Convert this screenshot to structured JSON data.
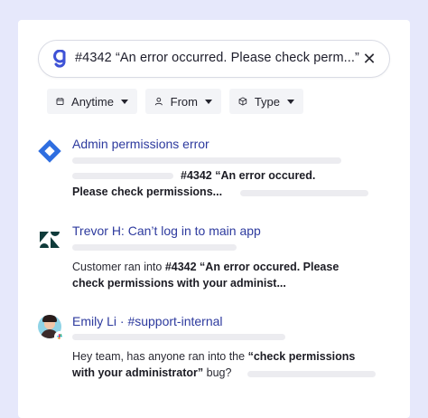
{
  "search": {
    "query": "#4342 “An error occurred. Please check perm...”",
    "clear_icon": "close-icon",
    "logo_icon": "g-logo-icon"
  },
  "filters": [
    {
      "label": "Anytime",
      "icon": "calendar-icon"
    },
    {
      "label": "From",
      "icon": "person-icon"
    },
    {
      "label": "Type",
      "icon": "cube-icon"
    }
  ],
  "results": [
    {
      "title": "Admin permissions error",
      "icon": "jira-icon",
      "snippet_line1_bold": "#4342 “An error occured.",
      "snippet_line2_bold": "Please check permissions..."
    },
    {
      "title": "Trevor H: Can’t log in to main app",
      "icon": "zendesk-icon",
      "snippet_line1_prefix": "Customer ran into ",
      "snippet_line1_bold": "#4342 “An error occured. Please",
      "snippet_line2_bold": "check permissions with your administ..."
    },
    {
      "title": "Emily Li · #support-internal",
      "icon": "avatar-slack",
      "snippet_line1_prefix": "Hey team, has anyone ran into the ",
      "snippet_line1_bold": "“check permissions",
      "snippet_line2_bold": "with your administrator”",
      "snippet_line2_suffix": " bug?"
    }
  ],
  "colors": {
    "background": "#e6e8fb",
    "link": "#2d3a9e",
    "jira": "#2f6ee0",
    "zendesk": "#0f3b3a"
  }
}
